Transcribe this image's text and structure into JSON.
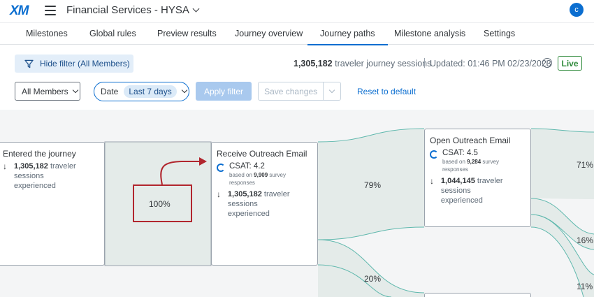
{
  "app": {
    "logo": "XM",
    "project_title": "Financial Services - HYSA",
    "avatar_initial": "c"
  },
  "tabs": [
    {
      "label": "Milestones"
    },
    {
      "label": "Global rules"
    },
    {
      "label": "Preview results"
    },
    {
      "label": "Journey overview"
    },
    {
      "label": "Journey paths",
      "active": true
    },
    {
      "label": "Milestone analysis"
    },
    {
      "label": "Settings"
    }
  ],
  "filter_bar": {
    "hide_filter_label": "Hide filter (All Members)",
    "sessions_count": "1,305,182",
    "sessions_suffix": "traveler journey sessions",
    "updated": "Updated: 01:46 PM 02/23/2023",
    "live_label": "Live"
  },
  "controls": {
    "members_select": "All Members",
    "date_label": "Date",
    "date_value": "Last 7 days",
    "apply_label": "Apply filter",
    "save_label": "Save changes",
    "reset_label": "Reset to default"
  },
  "journey": {
    "nodes": [
      {
        "title": "Entered the journey",
        "sessions": "1,305,182",
        "sessions_suffix": "traveler sessions",
        "sessions_suffix2": "experienced"
      },
      {
        "title": "Receive Outreach Email",
        "csat": "CSAT: 4.2",
        "based_on_prefix": "based on",
        "based_on_count": "9,909",
        "based_on_suffix": "survey",
        "responses": "responses",
        "sessions": "1,305,182",
        "sessions_suffix": "traveler sessions",
        "sessions_suffix2": "experienced"
      },
      {
        "title": "Open Outreach Email",
        "csat": "CSAT: 4.5",
        "based_on_prefix": "based on",
        "based_on_count": "9,284",
        "based_on_suffix": "survey",
        "responses": "responses",
        "sessions": "1,044,145",
        "sessions_suffix": "traveler sessions",
        "sessions_suffix2": "experienced"
      }
    ],
    "percentages": {
      "entered_to_receive": "100%",
      "receive_to_open": "79%",
      "receive_to_other": "20%",
      "open_next_1": "71%",
      "open_next_2": "16%",
      "open_next_3": "11%"
    }
  },
  "colors": {
    "accent": "#0b6ed0",
    "live": "#2e8a3a",
    "annotation": "#b1262e",
    "flow": "#e4ebe9",
    "flow_line": "#5fb8ad"
  }
}
